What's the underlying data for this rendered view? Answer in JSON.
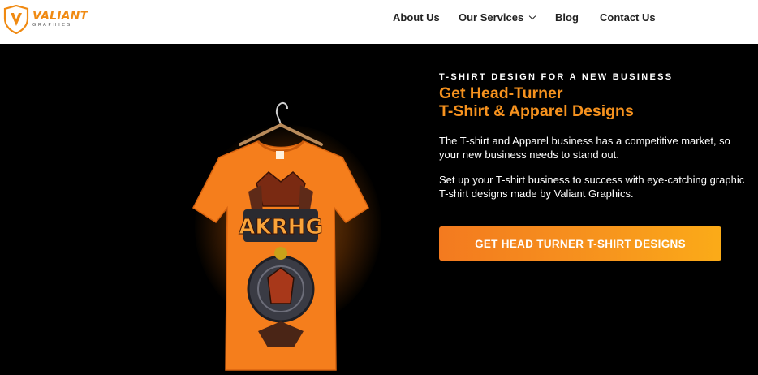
{
  "brand": {
    "name": "VALIANT",
    "tagline": "GRAPHICS",
    "accent_color": "#f08a12"
  },
  "nav": {
    "items": [
      {
        "label": "About Us"
      },
      {
        "label": "Our Services"
      },
      {
        "label": "Blog"
      },
      {
        "label": "Contact Us"
      }
    ],
    "services_icon": "chevron-down-icon"
  },
  "hero": {
    "eyebrow": "T-SHIRT DESIGN FOR A NEW BUSINESS",
    "headline_line1": "Get Head-Turner",
    "headline_line2": "T-Shirt & Apparel Designs",
    "paragraph1": "The T-shirt and Apparel business has a competitive market, so your new business needs to stand out.",
    "paragraph2": "Set up your T-shirt business to success with eye-catching graphic T-shirt designs made by Valiant Graphics.",
    "cta_label": "GET HEAD TURNER T-SHIRT DESIGNS",
    "shirt_print_text": "AKRHG",
    "colors": {
      "background": "#000000",
      "headline": "#f6921e",
      "cta_start": "#f37a1f",
      "cta_end": "#fbab18"
    }
  }
}
